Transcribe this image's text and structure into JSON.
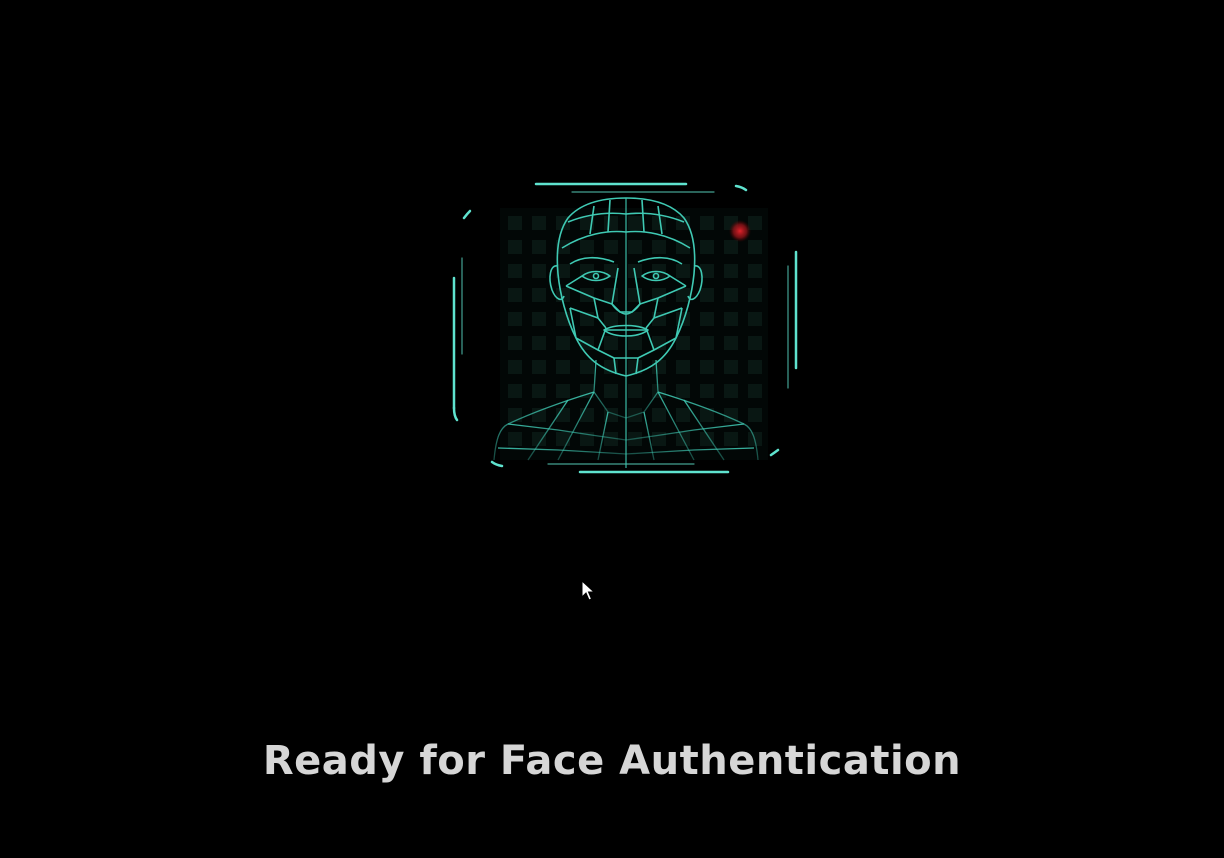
{
  "status": {
    "message": "Ready for Face Authentication"
  },
  "scanner": {
    "icon": "face-mesh-icon",
    "frame_color": "#5fe3cf",
    "mesh_color": "#3fc9b3",
    "indicator_color": "#c0141c"
  },
  "cursor": {
    "icon": "mouse-pointer-icon"
  }
}
